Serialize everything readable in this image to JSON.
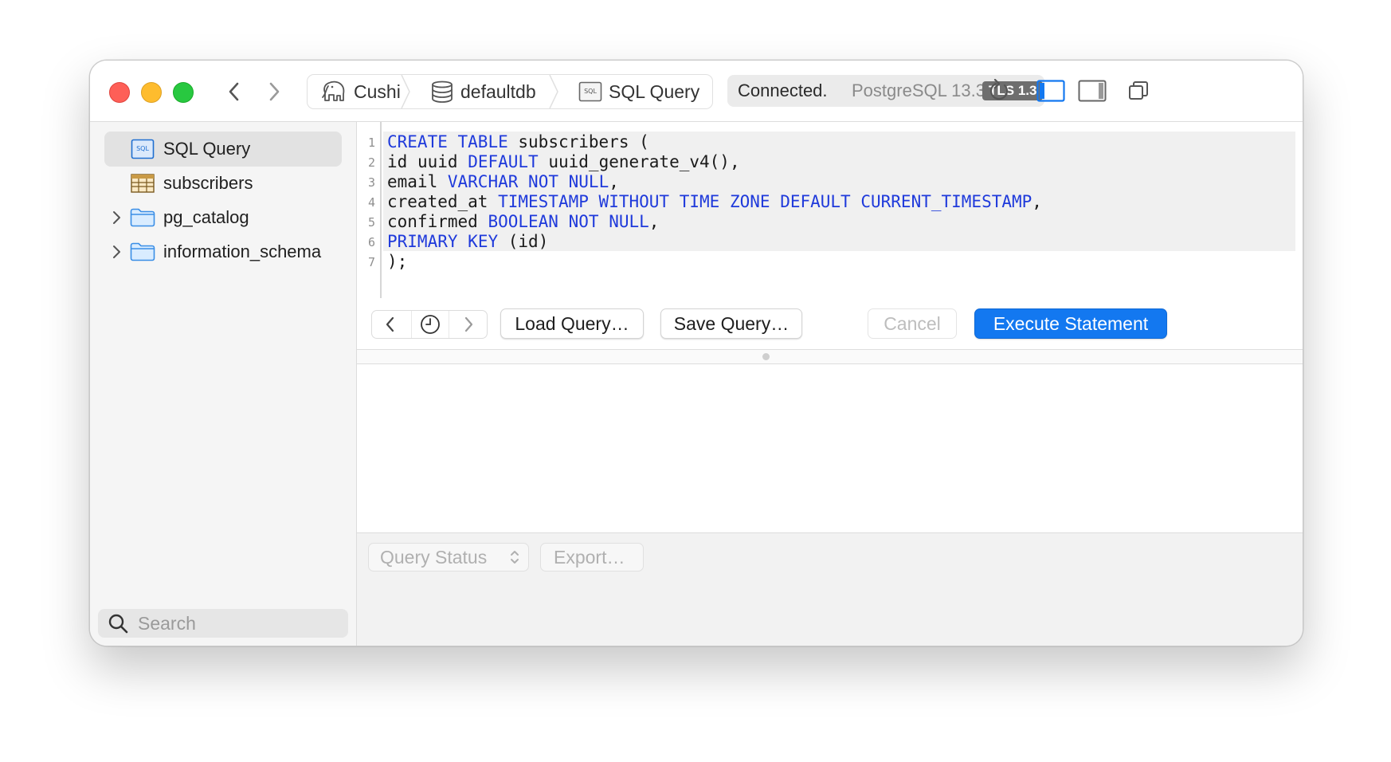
{
  "toolbar": {
    "breadcrumb": [
      {
        "label": "Cushi",
        "icon": "elephant-icon"
      },
      {
        "label": "defaultdb",
        "icon": "database-icon"
      },
      {
        "label": "SQL Query",
        "icon": "sql-icon"
      }
    ],
    "status": {
      "connected": "Connected.",
      "version": "PostgreSQL 13.3",
      "tls": "TLS 1.3"
    }
  },
  "sidebar": {
    "items": [
      {
        "label": "SQL Query",
        "icon": "sql-icon",
        "selected": true
      },
      {
        "label": "subscribers",
        "icon": "table-icon"
      },
      {
        "label": "pg_catalog",
        "icon": "folder-icon",
        "expandable": true
      },
      {
        "label": "information_schema",
        "icon": "folder-icon",
        "expandable": true
      }
    ],
    "search_placeholder": "Search"
  },
  "editor": {
    "line_numbers": [
      "1",
      "2",
      "3",
      "4",
      "5",
      "6",
      "7"
    ],
    "lines": [
      "CREATE TABLE subscribers (",
      "id uuid DEFAULT uuid_generate_v4(),",
      "email VARCHAR NOT NULL,",
      "created_at TIMESTAMP WITHOUT TIME ZONE DEFAULT CURRENT_TIMESTAMP,",
      "confirmed BOOLEAN NOT NULL,",
      "PRIMARY KEY (id)",
      ");"
    ],
    "keywords": [
      "CREATE",
      "TABLE",
      "DEFAULT",
      "VARCHAR",
      "NOT",
      "NULL",
      "TIMESTAMP",
      "WITHOUT",
      "TIME",
      "ZONE",
      "CURRENT_TIMESTAMP",
      "BOOLEAN",
      "PRIMARY",
      "KEY"
    ]
  },
  "query_bar": {
    "load": "Load Query…",
    "save": "Save Query…",
    "cancel": "Cancel",
    "execute": "Execute Statement"
  },
  "status_bar": {
    "query_status": "Query Status",
    "export": "Export…"
  },
  "colors": {
    "accent": "#1378f0",
    "keyword": "#1f3adb",
    "close": "#fe5f57",
    "minimize": "#febc2e",
    "zoom": "#28c840"
  }
}
